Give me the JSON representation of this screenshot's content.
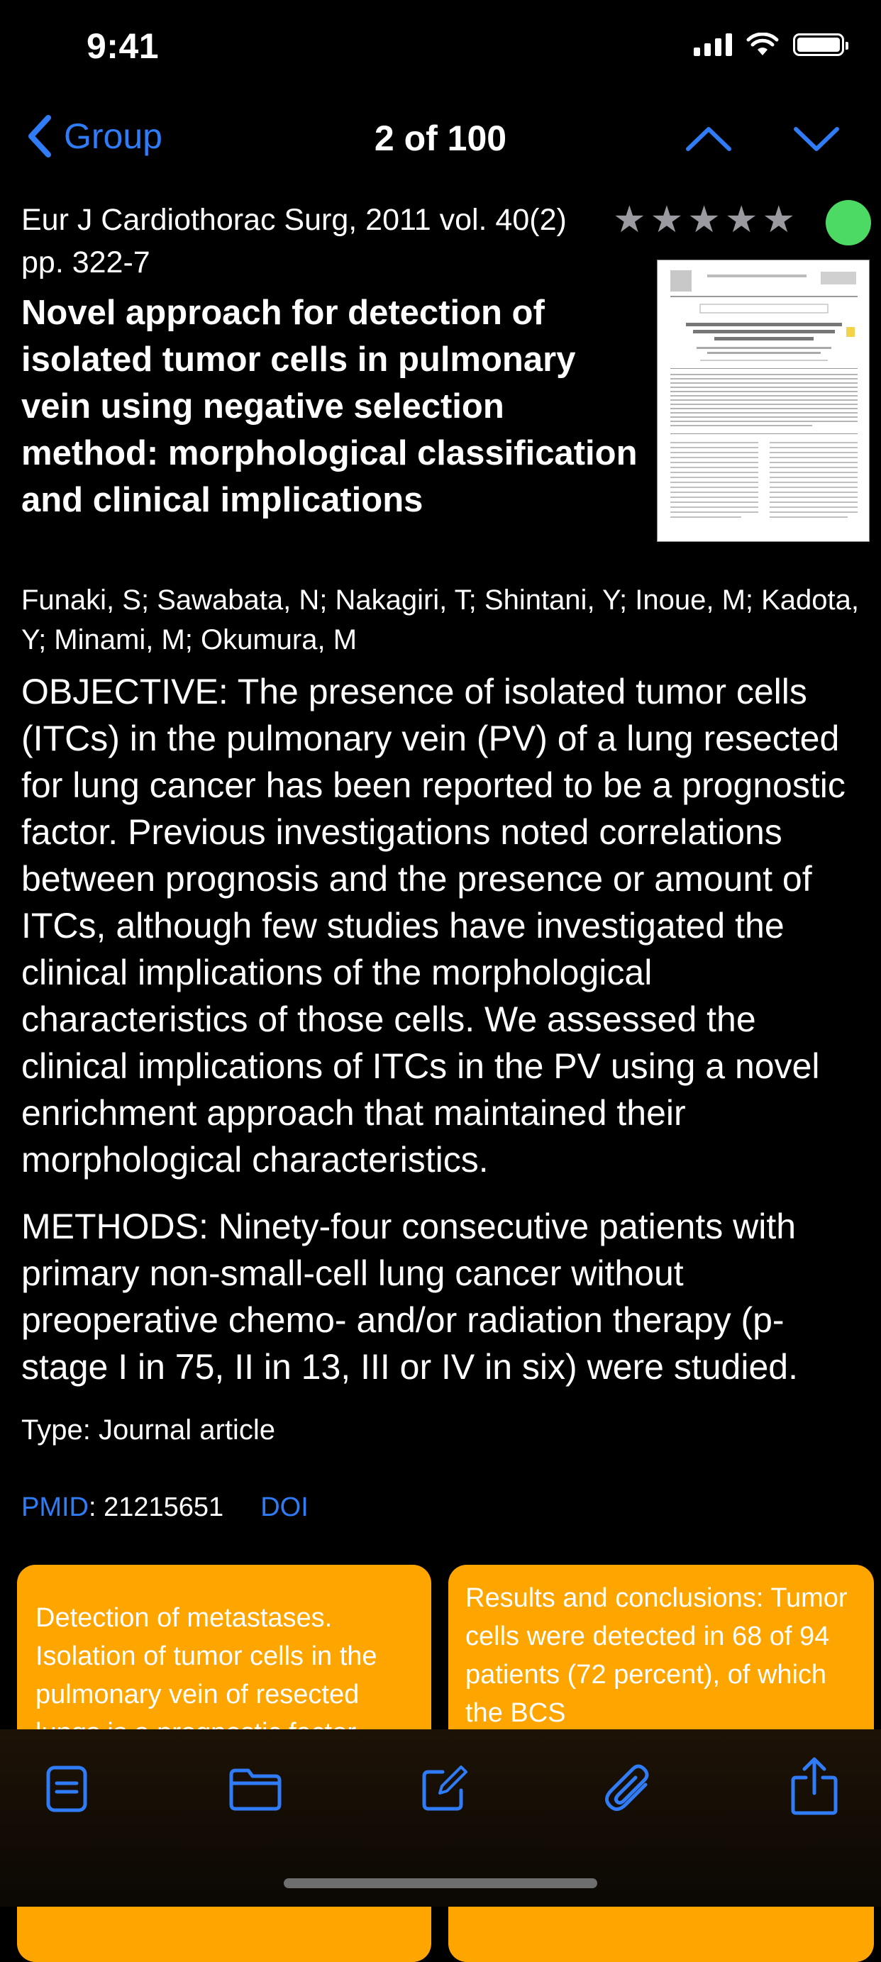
{
  "status_bar": {
    "time": "9:41"
  },
  "nav": {
    "back_label": "Group",
    "title": "2 of 100"
  },
  "article": {
    "journal": "Eur J Cardiothorac Surg, 2011 vol. 40(2) pp. 322-7",
    "rating_stars": 5,
    "status_color": "#4cd964",
    "title": "Novel approach for detection of isolated tumor cells in pulmonary vein using negative selection method: morphological classification and clinical implications",
    "authors": "Funaki, S; Sawabata, N; Nakagiri, T; Shintani, Y; Inoue, M; Kadota, Y; Minami, M; Okumura, M",
    "abstract_objective": "OBJECTIVE: The presence of isolated tumor cells (ITCs) in the pulmonary vein (PV) of a lung resected for lung cancer has been reported to be a prognostic factor. Previous investigations noted correlations between prognosis and the presence or amount of ITCs, although few studies have investigated the clinical implications of the morphological characteristics of those cells. We assessed the clinical implications of ITCs in the PV using a novel enrichment approach that maintained their morphological characteristics.",
    "abstract_methods": "METHODS: Ninety-four consecutive patients with primary non-small-cell lung cancer without preoperative chemo- and/or radiation therapy (p-stage I in 75, II in 13, III or IV in six) were studied.",
    "type": "Type: Journal article",
    "pmid_label": "PMID",
    "pmid_value": ": 21215651",
    "doi_label": "DOI"
  },
  "notes": [
    {
      "text": "Detection of metastases. Isolation of tumor cells in the pulmonary vein of resected lungs is a prognostic factor"
    },
    {
      "text": "Results and conclusions: Tumor cells were detected in 68 of 94 patients (72 percent), of which the BCS"
    }
  ],
  "toolbar": {
    "icons": [
      "notes-icon",
      "folder-icon",
      "compose-icon",
      "attachment-icon",
      "share-icon"
    ]
  },
  "colors": {
    "accent": "#2f7cf6",
    "note": "#ffa500",
    "background": "#000000"
  }
}
